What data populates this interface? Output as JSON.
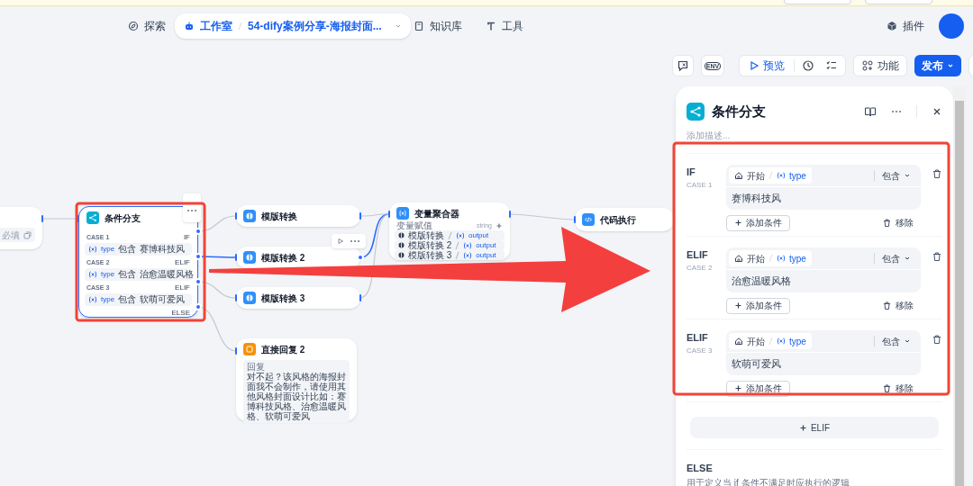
{
  "nav": {
    "items": [
      {
        "kind": "link",
        "label": "探索",
        "selected": false
      },
      {
        "kind": "studio",
        "label": "工作室",
        "breadcrumb": "54-dify案例分享-海报封面...",
        "selected": true
      },
      {
        "kind": "link",
        "label": "知识库",
        "selected": false
      },
      {
        "kind": "link",
        "label": "工具",
        "selected": false
      }
    ],
    "plugins": "插件"
  },
  "toolbar": {
    "env": "ENV",
    "preview": "预览",
    "features": "功能",
    "publish": "发布"
  },
  "canvas": {
    "nodes": [
      {
        "kind": "start",
        "tag": "必填"
      },
      {
        "kind": "if_else",
        "title": "条件分支",
        "selected": true,
        "else": "ELSE",
        "cases": [
          {
            "case": "CASE 1",
            "branch": "IF",
            "variable": "type",
            "operator": "包含",
            "value": "赛博科技风"
          },
          {
            "case": "CASE 2",
            "branch": "ELIF",
            "variable": "type",
            "operator": "包含",
            "value": "治愈温暖风格"
          },
          {
            "case": "CASE 3",
            "branch": "ELIF",
            "variable": "type",
            "operator": "包含",
            "value": "软萌可爱风"
          }
        ]
      },
      {
        "kind": "template",
        "title": "模版转换",
        "show_actions": false
      },
      {
        "kind": "template",
        "title": "模版转换 2",
        "show_actions": true
      },
      {
        "kind": "template",
        "title": "模版转换 3",
        "show_actions": false
      },
      {
        "kind": "answer",
        "title": "直接回复 2",
        "label": "回复",
        "text": "对不起？该风格的海报封面我不会制作，请使用其他风格封面设计比如：赛博科技风格、治愈温暖风格、软萌可爱风"
      },
      {
        "kind": "aggregator",
        "title": "变量聚合器",
        "label": "变量赋值",
        "type": "string",
        "items": [
          {
            "node": "模版转换",
            "variable": "output"
          },
          {
            "node": "模版转换 2",
            "variable": "output"
          },
          {
            "node": "模版转换 3",
            "variable": "output"
          }
        ]
      },
      {
        "kind": "code",
        "title": "代码执行"
      }
    ]
  },
  "panel": {
    "title": "条件分支",
    "description_placeholder": "添加描述...",
    "cases": [
      {
        "branch": "IF",
        "case": "CASE 1",
        "source": "开始",
        "variable": "type",
        "operator": "包含",
        "value": "赛博科技风",
        "add_label": "添加条件",
        "remove_label": "移除"
      },
      {
        "branch": "ELIF",
        "case": "CASE 2",
        "source": "开始",
        "variable": "type",
        "operator": "包含",
        "value": "治愈温暖风格",
        "add_label": "添加条件",
        "remove_label": "移除"
      },
      {
        "branch": "ELIF",
        "case": "CASE 3",
        "source": "开始",
        "variable": "type",
        "operator": "包含",
        "value": "软萌可爱风",
        "add_label": "添加条件",
        "remove_label": "移除"
      }
    ],
    "add_elif": "ELIF",
    "else_title": "ELSE",
    "else_description": "用于定义当 if 条件不满足时应执行的逻辑"
  }
}
